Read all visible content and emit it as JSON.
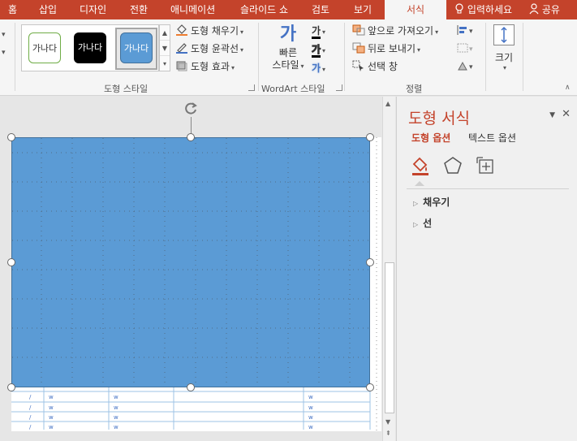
{
  "tabs": [
    {
      "label": "홈"
    },
    {
      "label": "삽입"
    },
    {
      "label": "디자인"
    },
    {
      "label": "전환"
    },
    {
      "label": "애니메이션"
    },
    {
      "label": "슬라이드 쇼"
    },
    {
      "label": "검토"
    },
    {
      "label": "보기"
    },
    {
      "label": "서식",
      "active": true
    }
  ],
  "tell_me": "입력하세요",
  "share": "공유",
  "ribbon": {
    "shape_styles": {
      "label": "도형 스타일",
      "swatches": [
        "가나다",
        "가나다",
        "가나다"
      ],
      "fill": "도형 채우기",
      "outline": "도형 윤곽선",
      "effects": "도형 효과"
    },
    "wordart": {
      "label": "WordArt 스타일",
      "quick_styles_line1": "빠른",
      "quick_styles_line2": "스타일",
      "glyph": "가"
    },
    "arrange": {
      "label": "정렬",
      "bring_forward": "앞으로 가져오기",
      "send_backward": "뒤로 보내기",
      "selection_pane": "선택 창"
    },
    "size": {
      "label": "크기"
    }
  },
  "format_pane": {
    "title": "도형 서식",
    "tab_shape": "도형 옵션",
    "tab_text": "텍스트 옵션",
    "sections": [
      "채우기",
      "선"
    ]
  },
  "colors": {
    "accent": "#c4432b",
    "shape_fill": "#5b9bd5",
    "shape_border": "#41719c"
  }
}
